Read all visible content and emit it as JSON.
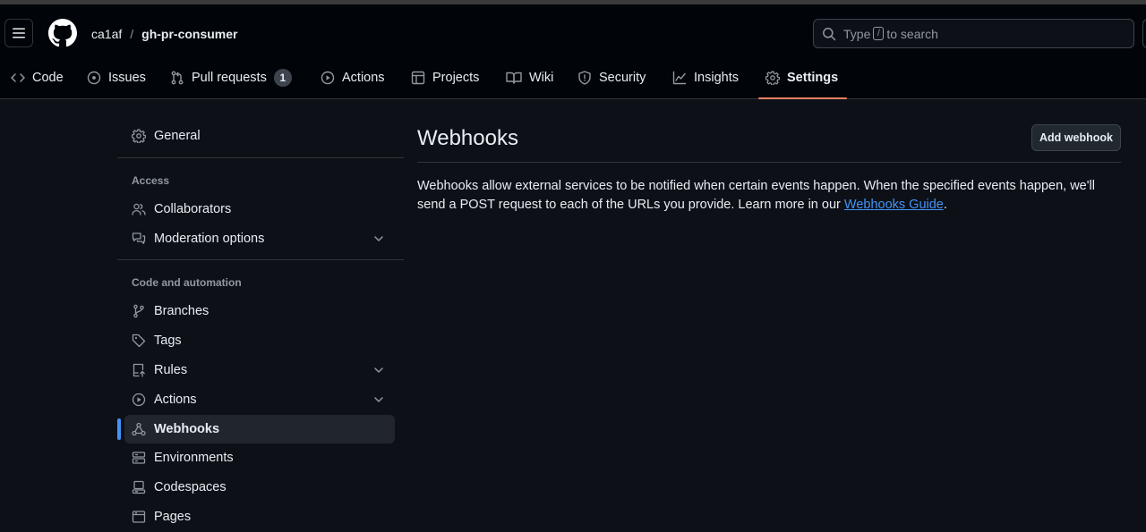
{
  "header": {
    "owner": "ca1af",
    "separator": "/",
    "repo": "gh-pr-consumer",
    "search": {
      "prefix": "Type",
      "key": "/",
      "suffix": "to search"
    }
  },
  "tabs": [
    {
      "label": "Code",
      "icon": "code-icon"
    },
    {
      "label": "Issues",
      "icon": "issue-opened-icon"
    },
    {
      "label": "Pull requests",
      "icon": "git-pull-request-icon",
      "counter": "1"
    },
    {
      "label": "Actions",
      "icon": "play-icon"
    },
    {
      "label": "Projects",
      "icon": "table-icon"
    },
    {
      "label": "Wiki",
      "icon": "book-icon"
    },
    {
      "label": "Security",
      "icon": "shield-icon"
    },
    {
      "label": "Insights",
      "icon": "graph-icon"
    },
    {
      "label": "Settings",
      "icon": "gear-icon",
      "selected": true
    }
  ],
  "sidebar": {
    "general": "General",
    "access_heading": "Access",
    "access_items": [
      {
        "label": "Collaborators",
        "icon": "people-icon"
      },
      {
        "label": "Moderation options",
        "icon": "comment-discussion-icon",
        "expandable": true
      }
    ],
    "automation_heading": "Code and automation",
    "automation_items": [
      {
        "label": "Branches",
        "icon": "git-branch-icon"
      },
      {
        "label": "Tags",
        "icon": "tag-icon"
      },
      {
        "label": "Rules",
        "icon": "repo-push-icon",
        "expandable": true
      },
      {
        "label": "Actions",
        "icon": "play-icon",
        "expandable": true
      },
      {
        "label": "Webhooks",
        "icon": "webhook-icon",
        "active": true
      },
      {
        "label": "Environments",
        "icon": "server-icon"
      },
      {
        "label": "Codespaces",
        "icon": "codespaces-icon"
      },
      {
        "label": "Pages",
        "icon": "browser-icon"
      }
    ]
  },
  "main": {
    "title": "Webhooks",
    "add_button": "Add webhook",
    "description_text": "Webhooks allow external services to be notified when certain events happen. When the specified events happen, we'll send a POST request to each of the URLs you provide. Learn more in our ",
    "description_link": "Webhooks Guide",
    "description_end": "."
  },
  "colors": {
    "background": "#0d1117",
    "header": "#010409",
    "accent_link": "#4493f8",
    "tab_underline": "#f78166",
    "border": "#30363d"
  }
}
